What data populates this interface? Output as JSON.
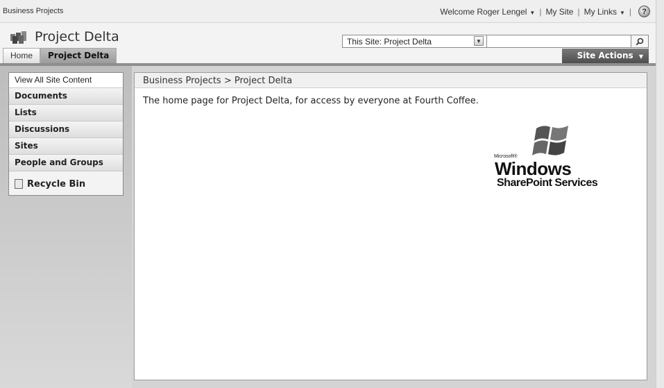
{
  "global": {
    "site_collection": "Business Projects",
    "welcome": "Welcome Roger Lengel",
    "my_site": "My Site",
    "my_links": "My Links",
    "separator": "|"
  },
  "title_area": {
    "site_title": "Project Delta",
    "search_scope": "This Site: Project Delta",
    "search_value": ""
  },
  "tabs": [
    {
      "label": "Home",
      "selected": false
    },
    {
      "label": "Project Delta",
      "selected": true
    }
  ],
  "site_actions": "Site Actions",
  "quick_launch": {
    "view_all": "View All Site Content",
    "headings": [
      "Documents",
      "Lists",
      "Discussions",
      "Sites",
      "People and Groups"
    ],
    "recycle_bin": "Recycle Bin"
  },
  "main": {
    "breadcrumb": "Business Projects > Project Delta",
    "description": "The home page for Project Delta, for access by everyone at Fourth Coffee."
  },
  "logo": {
    "microsoft": "Microsoft®",
    "windows": "Windows",
    "sharepoint_services": "SharePoint Services"
  },
  "colors": {
    "site_actions_bg": "#5e5e5e",
    "selected_tab_bg": "#a9a9a9",
    "nav_bg": "#c8c8c8"
  },
  "icons": [
    "site-logo-icon",
    "help-icon",
    "search-icon",
    "dropdown-arrow-icon",
    "recycle-bin-icon",
    "windows-flag-icon"
  ]
}
